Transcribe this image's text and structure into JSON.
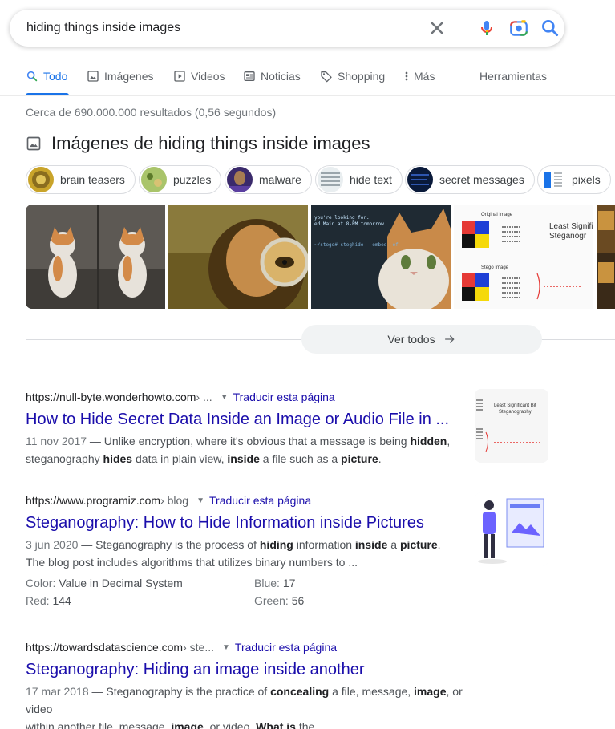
{
  "search": {
    "query": "hiding things inside images",
    "clear_icon": "close-icon",
    "mic_icon": "mic-icon",
    "lens_icon": "camera-lens-icon",
    "search_icon": "search-icon"
  },
  "tabs": [
    {
      "label": "Todo",
      "icon": "search-icon",
      "active": true
    },
    {
      "label": "Imágenes",
      "icon": "image-icon"
    },
    {
      "label": "Videos",
      "icon": "play-icon"
    },
    {
      "label": "Noticias",
      "icon": "news-icon"
    },
    {
      "label": "Shopping",
      "icon": "tag-icon"
    },
    {
      "label": "Más",
      "icon": "more-vert-icon"
    }
  ],
  "tools_label": "Herramientas",
  "result_stats": "Cerca de 690.000.000 resultados (0,56 segundos)",
  "images": {
    "heading": "Imágenes de hiding things inside images",
    "chips": [
      "brain teasers",
      "puzzles",
      "malware",
      "hide text",
      "secret messages",
      "pixels"
    ],
    "see_all": "Ver todos",
    "tile_text": {
      "code_line1": "you're looking for.",
      "code_line2": "ed Main at 8-PM tomorrow.",
      "code_line3": "~/stego# steghide --embed -ef",
      "original": "Original Image",
      "stego": "Stego Image",
      "lsb1": "Least Signific",
      "lsb2": "Steganogr"
    }
  },
  "results": [
    {
      "site": "https://null-byte.wonderhowto.com",
      "path": " › ...",
      "translate": "Traducir esta página",
      "title": "How to Hide Secret Data Inside an Image or Audio File in ...",
      "date": "11 nov 2017",
      "thumb_text": {
        "line1": "Least Significant Bit",
        "line2": "Steganography"
      }
    },
    {
      "site": "https://www.programiz.com",
      "path": " › blog",
      "translate": "Traducir esta página",
      "title": "Steganography: How to Hide Information inside Pictures",
      "date": "3 jun 2020",
      "attributes": [
        {
          "label": "Color:",
          "value": "Value in Decimal System"
        },
        {
          "label": "Blue:",
          "value": "17"
        },
        {
          "label": "Red:",
          "value": "144"
        },
        {
          "label": "Green:",
          "value": "56"
        }
      ]
    },
    {
      "site": "https://towardsdatascience.com",
      "path": " › ste...",
      "translate": "Traducir esta página",
      "title": "Steganography: Hiding an image inside another",
      "date": "17 mar 2018"
    }
  ],
  "snippets": {
    "r0": [
      "— Unlike encryption, where it's obvious that a message is being ",
      "hidden",
      ",",
      "steganography ",
      "hides",
      " data in plain view, ",
      "inside",
      " a file such as a ",
      "picture",
      "."
    ],
    "r1": [
      "— Steganography is the process of ",
      "hiding",
      " information ",
      "inside",
      " a ",
      "picture",
      ".",
      "The blog post includes algorithms that utilizes binary numbers to ..."
    ],
    "r2": [
      "— Steganography is the practice of ",
      "concealing",
      " a file, message, ",
      "image",
      ", or video",
      "within another file, message, ",
      "image",
      ", or video. ",
      "What is",
      " the ..."
    ]
  },
  "colors": {
    "link": "#1a0dab",
    "accent": "#1a73e8",
    "text": "#202124",
    "muted": "#70757a"
  }
}
